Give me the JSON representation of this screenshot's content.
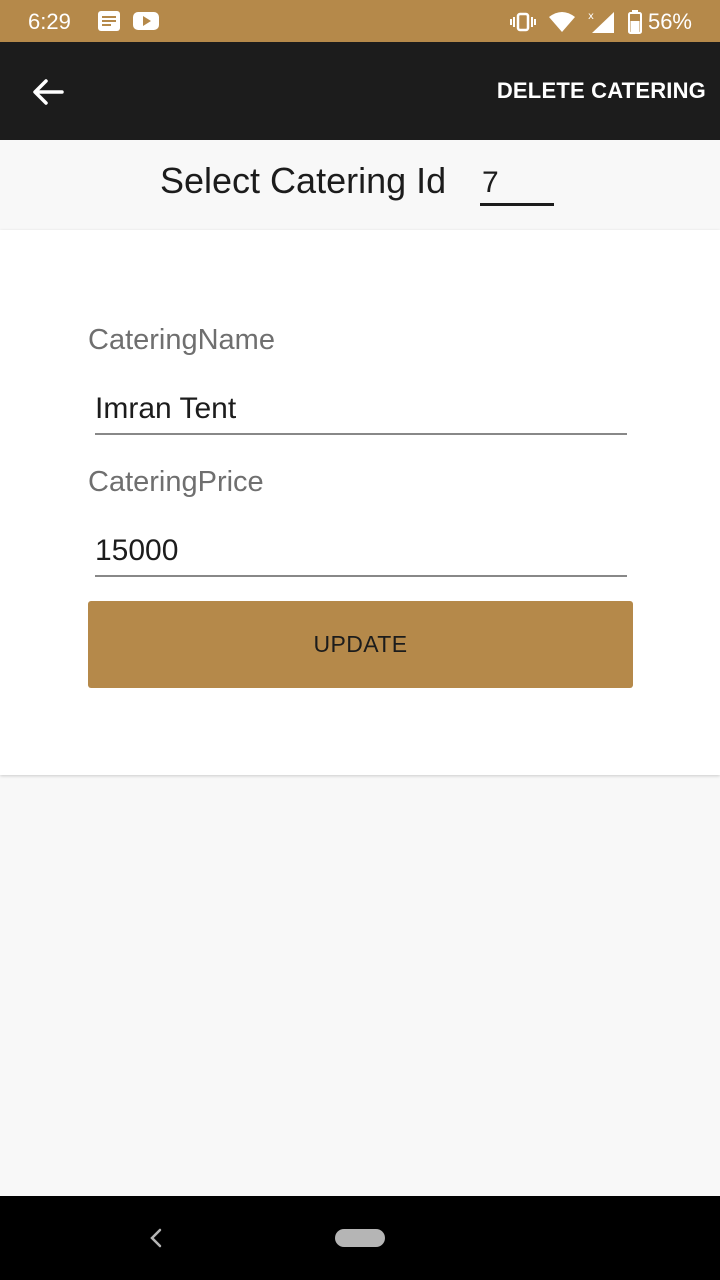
{
  "status_bar": {
    "time": "6:29",
    "battery": "56%",
    "icons": [
      "notes-icon",
      "youtube-icon",
      "vibrate-icon",
      "wifi-icon",
      "signal-icon",
      "battery-icon"
    ],
    "color": "#b5894a"
  },
  "app_bar": {
    "action_label": "DELETE CATERING",
    "background": "#1c1c1c"
  },
  "id_selector": {
    "label": "Select Catering Id",
    "value": "7"
  },
  "form": {
    "name_label": "CateringName",
    "name_value": "Imran Tent",
    "price_label": "CateringPrice",
    "price_value": "15000",
    "update_label": "UPDATE"
  },
  "accent_color": "#b5894a"
}
